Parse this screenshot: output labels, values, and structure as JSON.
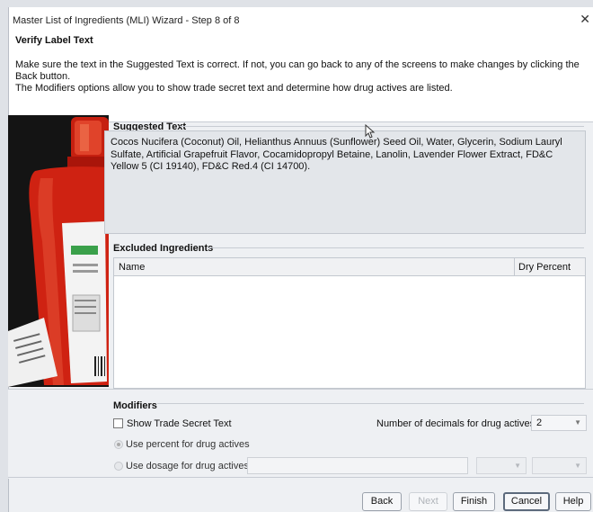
{
  "window": {
    "title": "Master List of Ingredients (MLI) Wizard - Step 8 of 8",
    "close_glyph": "✕"
  },
  "header": {
    "step_title": "Verify Label Text",
    "instructions_line1": "Make sure the text in the Suggested Text is correct. If not, you can go back to any of the screens to make changes by clicking the Back button.",
    "instructions_line2": "The Modifiers options allow you to show trade secret text and determine how drug actives are listed."
  },
  "image_panel": {
    "icon": "product-bottle-image"
  },
  "suggested": {
    "label": "Suggested Text",
    "text": "Cocos Nucifera (Coconut) Oil, Helianthus Annuus (Sunflower) Seed Oil, Water, Glycerin, Sodium Lauryl Sulfate, Artificial Grapefruit Flavor, Cocamidopropyl Betaine, Lanolin, Lavender Flower Extract, FD&C Yellow 5 (CI 19140), FD&C Red.4 (CI 14700)."
  },
  "excluded": {
    "label": "Excluded Ingredients",
    "columns": [
      "Name",
      "Dry Percent"
    ],
    "rows": []
  },
  "modifiers": {
    "label": "Modifiers",
    "show_trade_secret_label": "Show Trade Secret Text",
    "show_trade_secret_checked": false,
    "decimals_label": "Number of decimals for drug actives",
    "decimals_value": "2",
    "use_percent_label": "Use percent for drug actives",
    "use_percent_selected": true,
    "use_dosage_label": "Use dosage for drug actives",
    "use_dosage_selected": false
  },
  "buttons": {
    "back": "Back",
    "next": "Next",
    "finish": "Finish",
    "cancel": "Cancel",
    "help": "Help"
  },
  "colors": {
    "window_bg": "#eef0f3",
    "header_bg": "#ffffff",
    "suggested_bg": "#e3e6ea"
  }
}
